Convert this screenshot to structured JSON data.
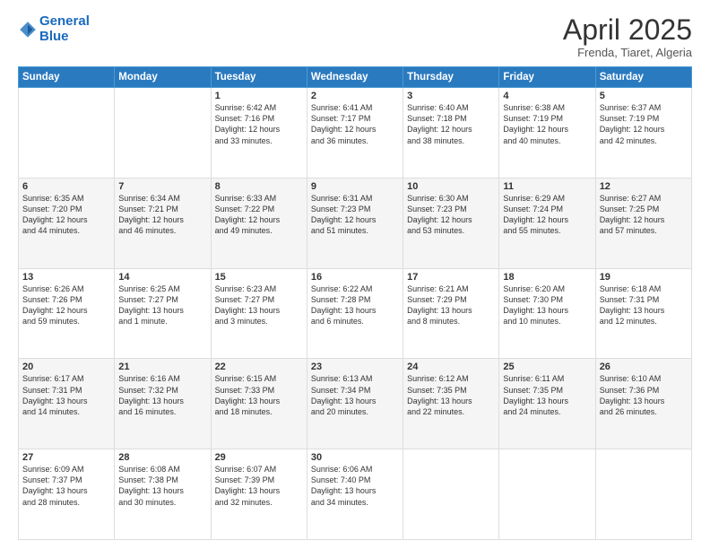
{
  "header": {
    "logo_line1": "General",
    "logo_line2": "Blue",
    "title": "April 2025",
    "subtitle": "Frenda, Tiaret, Algeria"
  },
  "weekdays": [
    "Sunday",
    "Monday",
    "Tuesday",
    "Wednesday",
    "Thursday",
    "Friday",
    "Saturday"
  ],
  "weeks": [
    [
      {
        "day": "",
        "info": ""
      },
      {
        "day": "",
        "info": ""
      },
      {
        "day": "1",
        "info": "Sunrise: 6:42 AM\nSunset: 7:16 PM\nDaylight: 12 hours\nand 33 minutes."
      },
      {
        "day": "2",
        "info": "Sunrise: 6:41 AM\nSunset: 7:17 PM\nDaylight: 12 hours\nand 36 minutes."
      },
      {
        "day": "3",
        "info": "Sunrise: 6:40 AM\nSunset: 7:18 PM\nDaylight: 12 hours\nand 38 minutes."
      },
      {
        "day": "4",
        "info": "Sunrise: 6:38 AM\nSunset: 7:19 PM\nDaylight: 12 hours\nand 40 minutes."
      },
      {
        "day": "5",
        "info": "Sunrise: 6:37 AM\nSunset: 7:19 PM\nDaylight: 12 hours\nand 42 minutes."
      }
    ],
    [
      {
        "day": "6",
        "info": "Sunrise: 6:35 AM\nSunset: 7:20 PM\nDaylight: 12 hours\nand 44 minutes."
      },
      {
        "day": "7",
        "info": "Sunrise: 6:34 AM\nSunset: 7:21 PM\nDaylight: 12 hours\nand 46 minutes."
      },
      {
        "day": "8",
        "info": "Sunrise: 6:33 AM\nSunset: 7:22 PM\nDaylight: 12 hours\nand 49 minutes."
      },
      {
        "day": "9",
        "info": "Sunrise: 6:31 AM\nSunset: 7:23 PM\nDaylight: 12 hours\nand 51 minutes."
      },
      {
        "day": "10",
        "info": "Sunrise: 6:30 AM\nSunset: 7:23 PM\nDaylight: 12 hours\nand 53 minutes."
      },
      {
        "day": "11",
        "info": "Sunrise: 6:29 AM\nSunset: 7:24 PM\nDaylight: 12 hours\nand 55 minutes."
      },
      {
        "day": "12",
        "info": "Sunrise: 6:27 AM\nSunset: 7:25 PM\nDaylight: 12 hours\nand 57 minutes."
      }
    ],
    [
      {
        "day": "13",
        "info": "Sunrise: 6:26 AM\nSunset: 7:26 PM\nDaylight: 12 hours\nand 59 minutes."
      },
      {
        "day": "14",
        "info": "Sunrise: 6:25 AM\nSunset: 7:27 PM\nDaylight: 13 hours\nand 1 minute."
      },
      {
        "day": "15",
        "info": "Sunrise: 6:23 AM\nSunset: 7:27 PM\nDaylight: 13 hours\nand 3 minutes."
      },
      {
        "day": "16",
        "info": "Sunrise: 6:22 AM\nSunset: 7:28 PM\nDaylight: 13 hours\nand 6 minutes."
      },
      {
        "day": "17",
        "info": "Sunrise: 6:21 AM\nSunset: 7:29 PM\nDaylight: 13 hours\nand 8 minutes."
      },
      {
        "day": "18",
        "info": "Sunrise: 6:20 AM\nSunset: 7:30 PM\nDaylight: 13 hours\nand 10 minutes."
      },
      {
        "day": "19",
        "info": "Sunrise: 6:18 AM\nSunset: 7:31 PM\nDaylight: 13 hours\nand 12 minutes."
      }
    ],
    [
      {
        "day": "20",
        "info": "Sunrise: 6:17 AM\nSunset: 7:31 PM\nDaylight: 13 hours\nand 14 minutes."
      },
      {
        "day": "21",
        "info": "Sunrise: 6:16 AM\nSunset: 7:32 PM\nDaylight: 13 hours\nand 16 minutes."
      },
      {
        "day": "22",
        "info": "Sunrise: 6:15 AM\nSunset: 7:33 PM\nDaylight: 13 hours\nand 18 minutes."
      },
      {
        "day": "23",
        "info": "Sunrise: 6:13 AM\nSunset: 7:34 PM\nDaylight: 13 hours\nand 20 minutes."
      },
      {
        "day": "24",
        "info": "Sunrise: 6:12 AM\nSunset: 7:35 PM\nDaylight: 13 hours\nand 22 minutes."
      },
      {
        "day": "25",
        "info": "Sunrise: 6:11 AM\nSunset: 7:35 PM\nDaylight: 13 hours\nand 24 minutes."
      },
      {
        "day": "26",
        "info": "Sunrise: 6:10 AM\nSunset: 7:36 PM\nDaylight: 13 hours\nand 26 minutes."
      }
    ],
    [
      {
        "day": "27",
        "info": "Sunrise: 6:09 AM\nSunset: 7:37 PM\nDaylight: 13 hours\nand 28 minutes."
      },
      {
        "day": "28",
        "info": "Sunrise: 6:08 AM\nSunset: 7:38 PM\nDaylight: 13 hours\nand 30 minutes."
      },
      {
        "day": "29",
        "info": "Sunrise: 6:07 AM\nSunset: 7:39 PM\nDaylight: 13 hours\nand 32 minutes."
      },
      {
        "day": "30",
        "info": "Sunrise: 6:06 AM\nSunset: 7:40 PM\nDaylight: 13 hours\nand 34 minutes."
      },
      {
        "day": "",
        "info": ""
      },
      {
        "day": "",
        "info": ""
      },
      {
        "day": "",
        "info": ""
      }
    ]
  ]
}
